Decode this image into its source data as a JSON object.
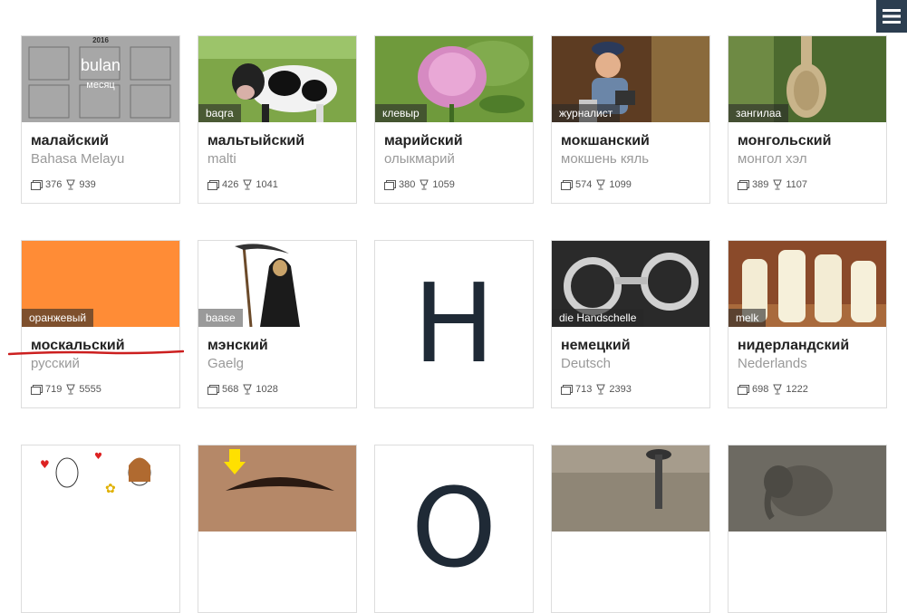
{
  "menu": {
    "icon": "hamburger-icon"
  },
  "row1": [
    {
      "name": "малайский",
      "native": "Bahasa Melayu",
      "comments": "376",
      "likes": "939",
      "img_word": "bulan",
      "img_word_sub": "месяц",
      "img_year": "2016"
    },
    {
      "name": "мальтыйский",
      "native": "malti",
      "comments": "426",
      "likes": "1041",
      "img_label": "baqra"
    },
    {
      "name": "марийский",
      "native": "олыкмарий",
      "comments": "380",
      "likes": "1059",
      "img_label": "клевыр"
    },
    {
      "name": "мокшанский",
      "native": "мокшень кяль",
      "comments": "574",
      "likes": "1099",
      "img_label": "журналист"
    },
    {
      "name": "монгольский",
      "native": "монгол хэл",
      "comments": "389",
      "likes": "1107",
      "img_label": "зангилаа"
    }
  ],
  "row2": [
    {
      "name": "москальский",
      "native": "русский",
      "comments": "719",
      "likes": "5555",
      "img_label": "оранжевый"
    },
    {
      "name": "мэнский",
      "native": "Gaelg",
      "comments": "568",
      "likes": "1028",
      "img_label": "baase"
    },
    {
      "letter": "Н"
    },
    {
      "name": "немецкий",
      "native": "Deutsch",
      "comments": "713",
      "likes": "2393",
      "img_label": "die Handschelle"
    },
    {
      "name": "нидерландский",
      "native": "Nederlands",
      "comments": "698",
      "likes": "1222",
      "img_label": "melk"
    }
  ],
  "row3": [
    {
      "letter": "О"
    }
  ]
}
